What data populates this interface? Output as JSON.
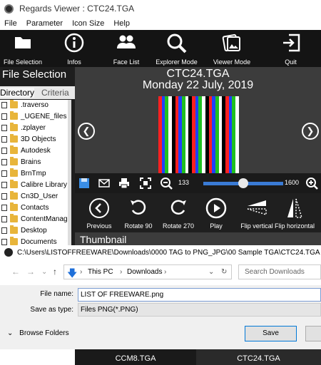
{
  "window": {
    "title": "Regards Viewer : CTC24.TGA"
  },
  "menu": [
    "File",
    "Parameter",
    "Icon Size",
    "Help"
  ],
  "toolbar": [
    {
      "label": "File Selection",
      "icon": "folder-icon"
    },
    {
      "label": "Infos",
      "icon": "info-icon"
    },
    {
      "label": "Face List",
      "icon": "people-icon"
    },
    {
      "label": "Explorer Mode",
      "icon": "magnifier-icon"
    },
    {
      "label": "Viewer Mode",
      "icon": "photo-viewer-icon"
    },
    {
      "label": "Quit",
      "icon": "exit-icon"
    }
  ],
  "left_panel": {
    "title": "File Selection",
    "tabs": [
      "Directory",
      "Criteria"
    ],
    "folders": [
      ".traverso",
      "_UGENE_files",
      ".zplayer",
      "3D Objects",
      "Autodesk",
      "Brains",
      "BrnTmp",
      "Calibre Library",
      "Cn3D_User",
      "Contacts",
      "ContentManager",
      "Desktop",
      "Documents"
    ]
  },
  "viewer": {
    "file_name": "CTC24.TGA",
    "date": "Monday 22 July, 2019",
    "stripe_colors": [
      "#ff2020",
      "#2040ff",
      "#20c020",
      "#ffffff",
      "#000000",
      "#ff2020",
      "#2040ff",
      "#20c020",
      "#ffffff",
      "#000000",
      "#ff2020",
      "#2040ff",
      "#20c020",
      "#ffffff",
      "#000000",
      "#ff2020",
      "#2040ff",
      "#20c020",
      "#ffffff",
      "#000000",
      "#ff2020",
      "#2040ff",
      "#20c020",
      "#ffffff"
    ]
  },
  "controls": {
    "zoom_min": "133",
    "zoom_max": "1600",
    "zoom_level": 0.5
  },
  "actions": [
    {
      "label": "Previous",
      "icon": "previous-icon"
    },
    {
      "label": "Rotate 90",
      "icon": "rotate-left-icon"
    },
    {
      "label": "Rotate 270",
      "icon": "rotate-right-icon"
    },
    {
      "label": "Play",
      "icon": "play-icon"
    },
    {
      "label": "Flip vertical",
      "icon": "flip-vertical-icon"
    },
    {
      "label": "Flip horizontal",
      "icon": "flip-horizontal-icon"
    }
  ],
  "thumbnail_label": "Thumbnail",
  "dialog": {
    "path": "C:\\Users\\LISTOFFREEWARE\\Downloads\\0000 TAG to PNG_JPG\\00 Sample TGA\\CTC24.TGA",
    "breadcrumb": [
      "This PC",
      "Downloads"
    ],
    "search_placeholder": "Search Downloads",
    "file_name_label": "File name:",
    "file_name_value": "LIST OF FREEWARE.png",
    "save_type_label": "Save as type:",
    "save_type_value": "Files PNG(*.PNG)",
    "browse_label": "Browse Folders",
    "save_label": "Save"
  },
  "thumbnails": [
    "CCM8.TGA",
    "CTC24.TGA"
  ]
}
